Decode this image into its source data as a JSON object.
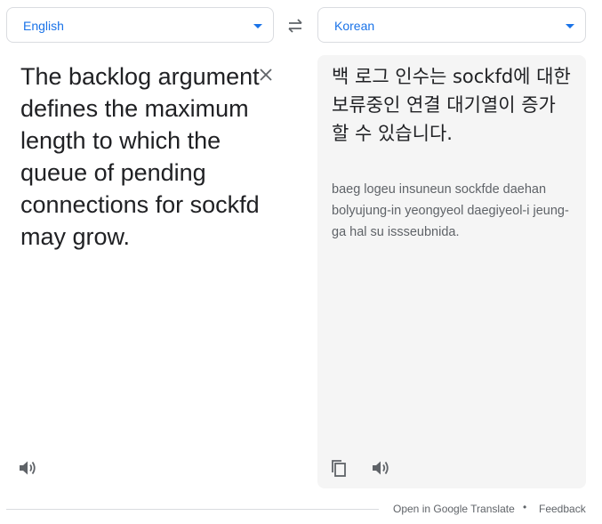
{
  "source_language": {
    "label": "English"
  },
  "target_language": {
    "label": "Korean"
  },
  "source": {
    "text": "The backlog argument defines the maximum length to which the queue of pending connections for sockfd may grow."
  },
  "target": {
    "text": "백 로그 인수는 sockfd에 대한 보류중인 연결 대기열이 증가 할 수 있습니다.",
    "romanization": "baeg logeu insuneun sockfde daehan bolyujung-in yeongyeol daegiyeol-i jeung-ga hal su issseubnida."
  },
  "footer": {
    "open_link": "Open in Google Translate",
    "separator": "•",
    "feedback_link": "Feedback"
  },
  "icons": {
    "swap": "swap-arrows-icon",
    "clear": "close-icon",
    "speaker": "speaker-icon",
    "copy": "copy-icon"
  },
  "colors": {
    "accent": "#1a73e8",
    "panel_bg": "#f5f5f5",
    "text_primary": "#202124",
    "text_secondary": "#5f6368",
    "border": "#dadce0"
  }
}
